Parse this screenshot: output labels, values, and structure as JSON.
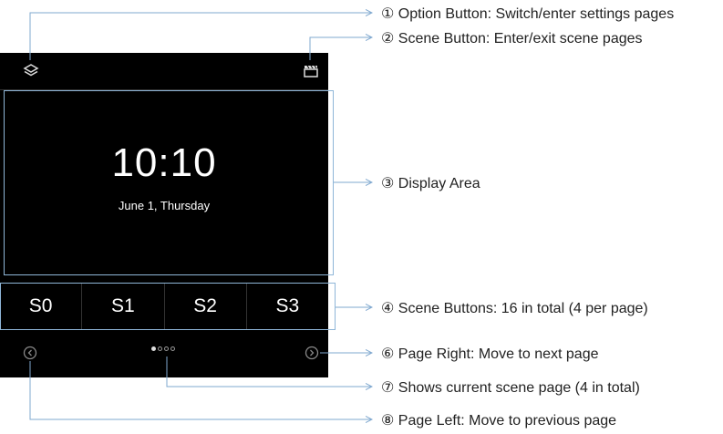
{
  "device": {
    "time": "10:10",
    "date": "June 1, Thursday",
    "scene_buttons": [
      "S0",
      "S1",
      "S2",
      "S3"
    ],
    "page_indicator": {
      "current_page": 1,
      "total_pages": 4
    }
  },
  "icons": {
    "option": "layers-icon",
    "scene": "clapperboard-icon",
    "page_left": "chevron-left-circle-icon",
    "page_right": "chevron-right-circle-icon"
  },
  "callouts": {
    "c1": "① Option Button: Switch/enter settings pages",
    "c2": "② Scene Button: Enter/exit scene pages",
    "c3": "③ Display Area",
    "c4": "④ Scene Buttons: 16 in total (4 per page)",
    "c6": "⑥ Page Right: Move to next page",
    "c7": "⑦ Shows current scene page (4 in total)",
    "c8": "⑧ Page Left: Move to previous page"
  },
  "colors": {
    "panel": "#000000",
    "leader": "#7fa8cf",
    "text": "#222222"
  }
}
